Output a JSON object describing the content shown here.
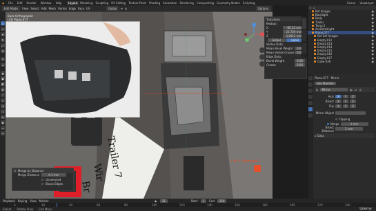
{
  "menubar": {
    "items": [
      "File",
      "Edit",
      "Render",
      "Window",
      "Help"
    ],
    "workspaces": [
      "Layout",
      "Modeling",
      "Sculpting",
      "UV Editing",
      "Texture Paint",
      "Shading",
      "Animation",
      "Rendering",
      "Compositing",
      "Geometry Nodes",
      "Scripting"
    ],
    "active_workspace": "Layout",
    "scene": "Scene",
    "view_layer": "ViewLayer"
  },
  "header": {
    "mode": "Edit Mode",
    "menus": [
      "View",
      "Select",
      "Add",
      "Mesh",
      "Vertex",
      "Edge",
      "Face",
      "UV"
    ],
    "orientation": "Global",
    "pivot": "Options"
  },
  "viewport": {
    "view_name": "Back Orthographic",
    "object_name": "(31) Plane.077",
    "overlay_text": "Ctrl + Numpad 1",
    "overlay_color": "#e8502a",
    "decal_text_1": "Trailer 7",
    "decal_text_2": "Wir",
    "decal_text_3": "Br"
  },
  "npanel": {
    "title": "Transform",
    "section": "Median:",
    "x": "-85.12 mm",
    "y": "25.729 mm",
    "z": "3.8912 mm",
    "global": "Global",
    "local": "Local",
    "vertex_data": "Vertex Data:",
    "mean_bevel_weight_label": "Mean Bevel Weight",
    "mean_bevel_weight": "0.00",
    "mean_vertex_crease_label": "Mean Vertex Crease",
    "mean_vertex_crease": "0.00",
    "edge_data": "Edge Data:",
    "bevel_weight_label": "Bevel Weight",
    "bevel_weight": "0.00",
    "crease_label": "Crease",
    "crease": "0.00"
  },
  "mirror_panel": {
    "title": "Merge by Distance",
    "merge_distance_label": "Merge Distance",
    "merge_distance": "0.1 mm",
    "unselected": "Unselected",
    "sharp_edges": "Sharp Edges"
  },
  "outliner": {
    "items": [
      "Ref Images",
      "Backlight",
      "Body",
      "Trailer",
      "Temp 2",
      "ArcDetaillight",
      "Plane.077",
      "Ref Ref Images",
      "Empty.012",
      "Empty.013",
      "Empty.014",
      "Empty.015",
      "Empty.016",
      "Empty.017",
      "Cube.036"
    ]
  },
  "properties": {
    "object_name": "Plane.077",
    "modifier_tab": "Mirror",
    "add_modifier": "Add Modifier",
    "modifier_name": "Mirror",
    "axis_label": "Axis",
    "bisect_label": "Bisect",
    "flip_label": "Flip",
    "x": "X",
    "y": "Y",
    "z": "Z",
    "mirror_object_label": "Mirror Object",
    "clipping": "Clipping",
    "merge_label": "Merge",
    "merge_value": "1 mm",
    "bisect_distance_label": "Bisect Distance",
    "bisect_distance_value": "1 mm",
    "data_label": "Data"
  },
  "timeline": {
    "playback": "Playback",
    "keying": "Keying",
    "view": "View",
    "marker": "Marker",
    "frame": "31",
    "start_label": "Start",
    "start": "1",
    "end_label": "End",
    "end": "250",
    "ticks": [
      "0",
      "20",
      "40",
      "60",
      "80",
      "100",
      "120",
      "140",
      "160",
      "180",
      "200",
      "220",
      "240"
    ],
    "status_select": "Select",
    "status_rotate": "Rotate View",
    "status_call": "Call Menu",
    "watermark": "Udemy"
  }
}
